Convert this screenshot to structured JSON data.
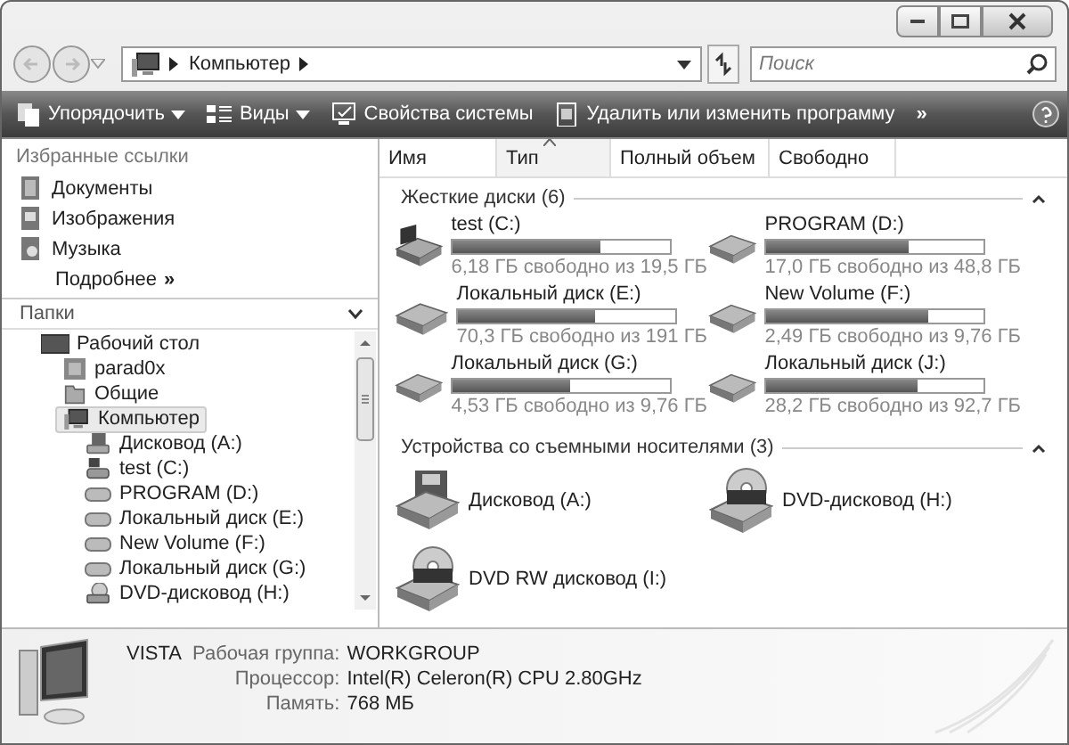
{
  "address_bar": {
    "path": [
      "Компьютер"
    ],
    "search": {
      "placeholder": "Поиск"
    }
  },
  "toolbar": {
    "items": [
      {
        "label": "Упорядочить",
        "kind": "menu"
      },
      {
        "label": "Виды",
        "kind": "menu"
      },
      {
        "label": "Свойства системы",
        "kind": "button"
      },
      {
        "label": "Удалить или изменить программу",
        "kind": "button"
      }
    ],
    "more": "»"
  },
  "favorites": {
    "title": "Избранные ссылки",
    "items": [
      {
        "label": "Документы"
      },
      {
        "label": "Изображения"
      },
      {
        "label": "Музыка"
      }
    ],
    "more": "Подробнее",
    "more_glyph": "»"
  },
  "folders": {
    "title": "Папки",
    "tree": [
      {
        "label": "Рабочий стол",
        "kind": "desktop",
        "selected": false,
        "children": [
          {
            "label": "parad0x",
            "kind": "user",
            "selected": false
          },
          {
            "label": "Общие",
            "kind": "folder",
            "selected": false
          },
          {
            "label": "Компьютер",
            "kind": "computer",
            "selected": true,
            "children": [
              {
                "label": "Дисковод (A:)",
                "kind": "floppy",
                "selected": false
              },
              {
                "label": "test (C:)",
                "kind": "sysdisk",
                "selected": false
              },
              {
                "label": "PROGRAM (D:)",
                "kind": "disk",
                "selected": false
              },
              {
                "label": "Локальный диск (E:)",
                "kind": "disk",
                "selected": false
              },
              {
                "label": "New Volume (F:)",
                "kind": "disk",
                "selected": false
              },
              {
                "label": "Локальный диск (G:)",
                "kind": "disk",
                "selected": false
              },
              {
                "label": "DVD-дисковод (H:)",
                "kind": "dvd",
                "selected": false
              }
            ]
          }
        ]
      }
    ]
  },
  "columns": [
    {
      "label": "Имя",
      "sorted": false
    },
    {
      "label": "Тип",
      "sorted": true
    },
    {
      "label": "Полный объем",
      "sorted": false
    },
    {
      "label": "Свободно",
      "sorted": false
    }
  ],
  "groups": [
    {
      "title": "Жесткие диски (6)",
      "items": [
        {
          "name": "test (C:)",
          "kind": "sysdisk",
          "level": 0.68,
          "caption": "6,18 ГБ свободно из 19,5 ГБ"
        },
        {
          "name": "PROGRAM (D:)",
          "kind": "disk",
          "level": 0.65,
          "caption": "17,0 ГБ свободно из 48,8 ГБ"
        },
        {
          "name": "Локальный диск (E:)",
          "kind": "disk",
          "level": 0.63,
          "caption": "70,3 ГБ свободно из 191 ГБ"
        },
        {
          "name": "New Volume (F:)",
          "kind": "disk",
          "level": 0.745,
          "caption": "2,49 ГБ свободно из 9,76 ГБ"
        },
        {
          "name": "Локальный диск (G:)",
          "kind": "disk",
          "level": 0.536,
          "caption": "4,53 ГБ свободно из 9,76 ГБ"
        },
        {
          "name": "Локальный диск (J:)",
          "kind": "disk",
          "level": 0.696,
          "caption": "28,2 ГБ свободно из 92,7 ГБ"
        }
      ]
    },
    {
      "title": "Устройства со съемными носителями (3)",
      "items": [
        {
          "name": "Дисковод (A:)",
          "kind": "floppy"
        },
        {
          "name": "DVD-дисковод (H:)",
          "kind": "dvd"
        },
        {
          "name": "DVD RW дисковод (I:)",
          "kind": "dvd"
        }
      ]
    }
  ],
  "details": {
    "name": "VISTA",
    "fields": [
      {
        "label": "Рабочая группа:",
        "value": "WORKGROUP"
      },
      {
        "label": "Процессор:",
        "value": "Intel(R) Celeron(R) CPU 2.80GHz"
      },
      {
        "label": "Память:",
        "value": "768 МБ"
      }
    ]
  }
}
